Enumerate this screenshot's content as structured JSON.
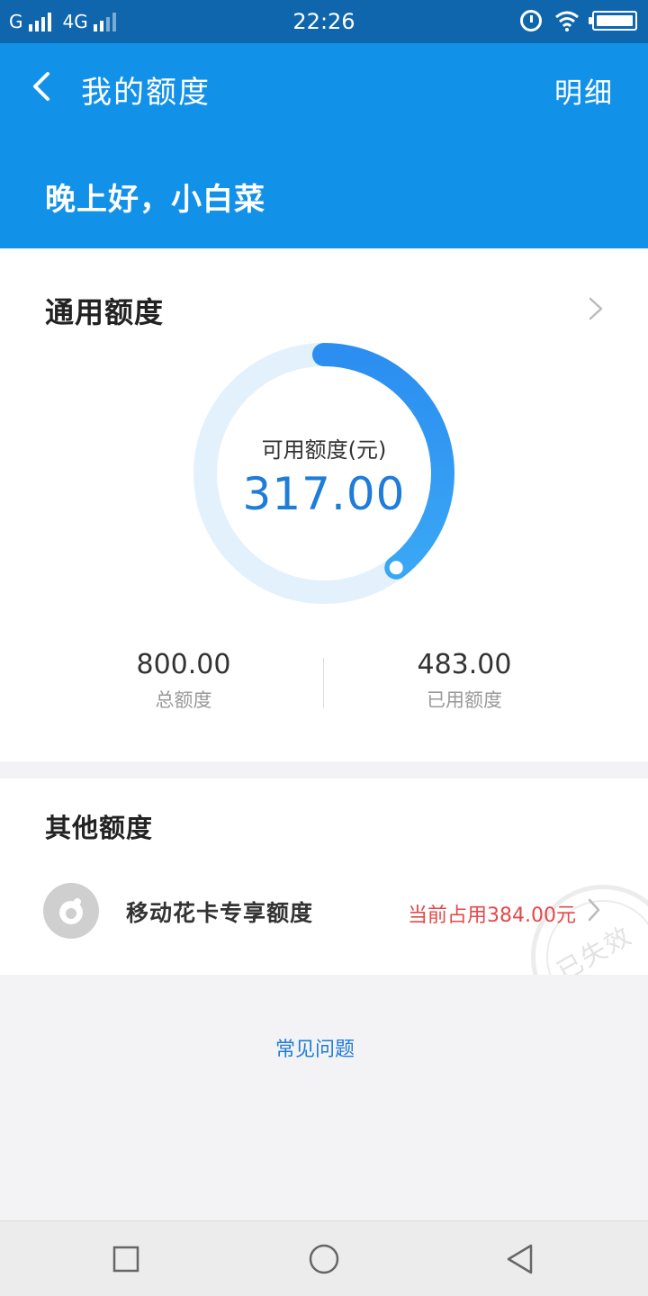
{
  "status_bar": {
    "network1": "G",
    "network2": "4G",
    "time": "22:26",
    "icons": [
      "signal-icon",
      "alarm-icon",
      "wifi-icon",
      "battery-icon"
    ]
  },
  "header": {
    "title": "我的额度",
    "detail": "明细",
    "greeting": "晚上好，小白菜"
  },
  "general_quota": {
    "title": "通用额度",
    "available_label": "可用额度(元)",
    "available_value": "317.00",
    "total_value": "800.00",
    "total_label": "总额度",
    "used_value": "483.00",
    "used_label": "已用额度",
    "ring_fraction": 0.396
  },
  "other_quota": {
    "title": "其他额度",
    "item_name": "移动花卡专享额度",
    "item_usage": "当前占用384.00元",
    "stamp_text": "已失效"
  },
  "faq": "常见问题",
  "colors": {
    "header_bg": "#1291e8",
    "status_bg": "#0f66ad",
    "accent": "#1f7cd8",
    "warning": "#e54848",
    "ring_track": "#e3f1fc",
    "ring_fill": "#2d8ff0"
  }
}
